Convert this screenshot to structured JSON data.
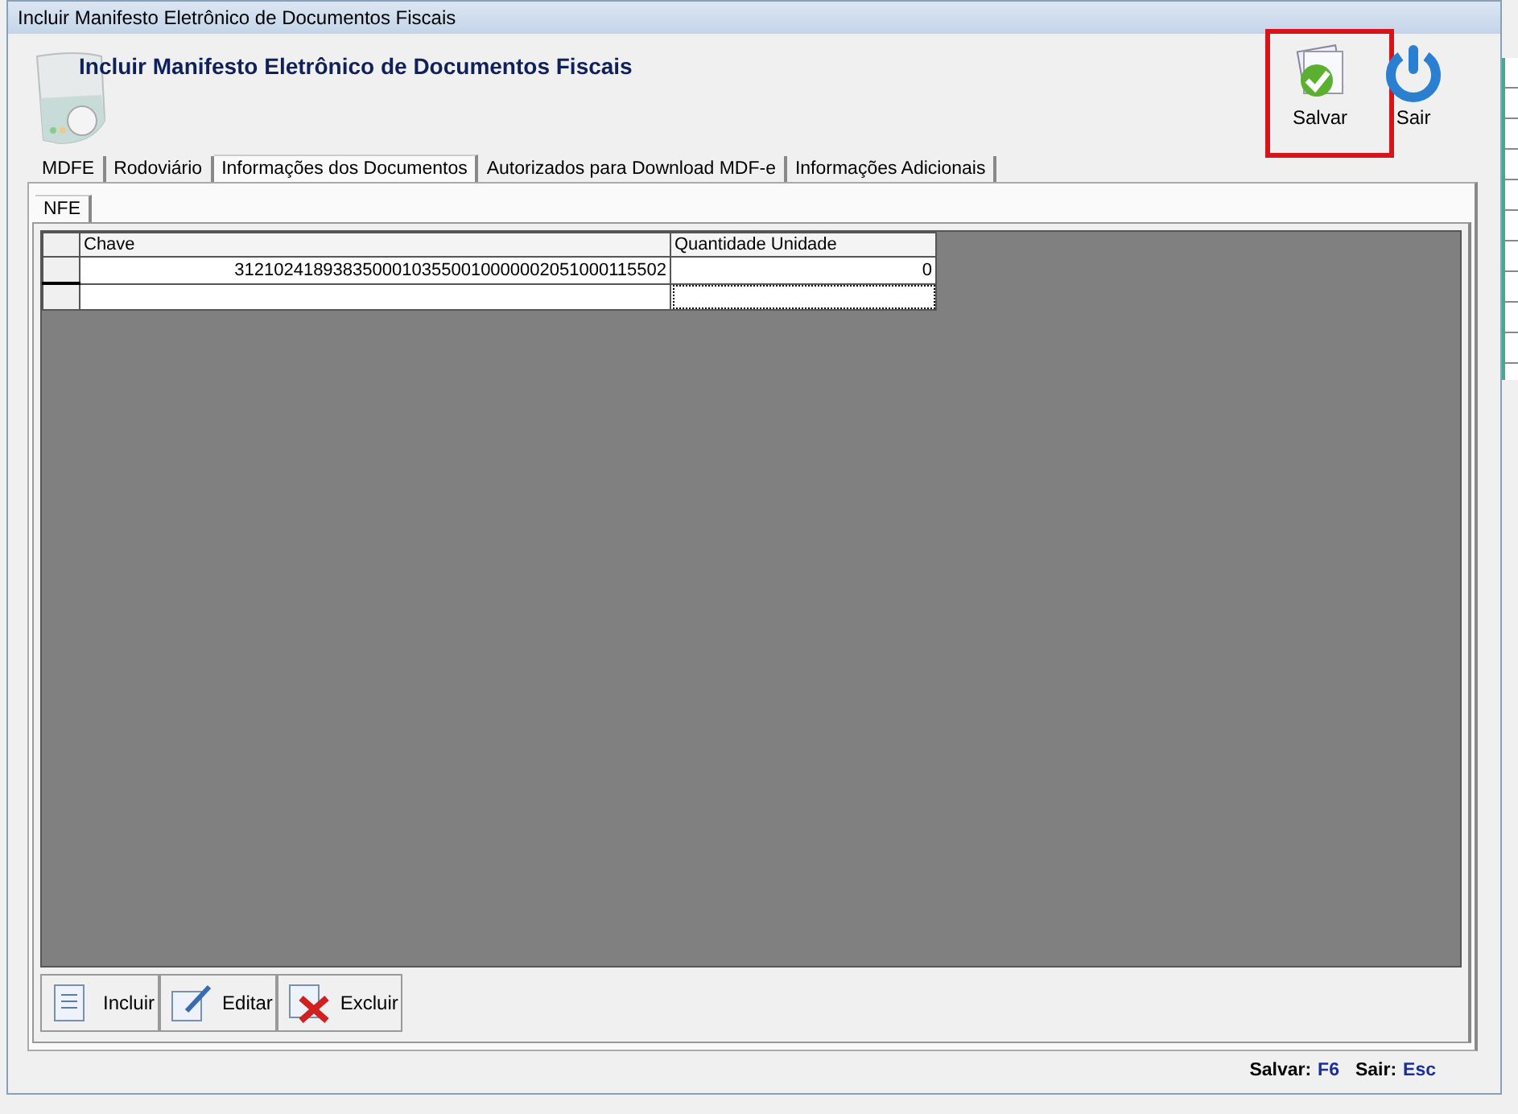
{
  "window": {
    "title": "Incluir Manifesto Eletrônico de Documentos Fiscais"
  },
  "header": {
    "title": "Incluir Manifesto Eletrônico de Documentos Fiscais"
  },
  "toolbar": [
    {
      "label": "Salvar",
      "kind": "save",
      "highlighted": true
    },
    {
      "label": "Sair",
      "kind": "exit",
      "highlighted": false
    }
  ],
  "tabs": [
    {
      "label": "MDFE",
      "selected": false
    },
    {
      "label": "Rodoviário",
      "selected": false
    },
    {
      "label": "Informações dos Documentos",
      "selected": true
    },
    {
      "label": "Autorizados para Download MDF-e",
      "selected": false
    },
    {
      "label": "Informações Adicionais",
      "selected": false
    }
  ],
  "subtabs": [
    {
      "label": "NFE",
      "selected": true
    }
  ],
  "table": {
    "columns": [
      "Chave",
      "Quantidade Unidade"
    ],
    "rows": [
      {
        "cells": [
          "31210241893835000103550010000002051000115502",
          "0"
        ],
        "selected": false
      },
      {
        "cells": [
          "",
          ""
        ],
        "selected": true
      }
    ]
  },
  "actions": [
    {
      "label": "Incluir",
      "kind": "add"
    },
    {
      "label": "Editar",
      "kind": "edit"
    },
    {
      "label": "Excluir",
      "kind": "delete"
    }
  ],
  "status_bar": [
    {
      "label": "Salvar:",
      "key": "F6"
    },
    {
      "label": "Sair:",
      "key": "Esc"
    }
  ]
}
